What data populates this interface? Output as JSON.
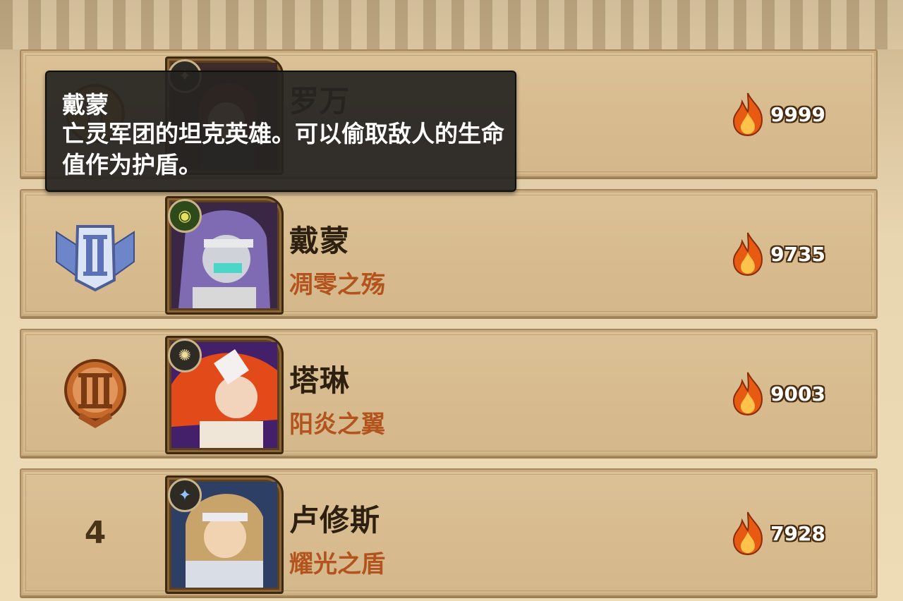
{
  "tooltip": {
    "title": "戴蒙",
    "description": "亡灵军团的坦克英雄。可以偷取敌人的生命值作为护盾。"
  },
  "leaderboard": {
    "entries": [
      {
        "rank_icon": "rank-1-emblem",
        "name": "罗万",
        "title": "",
        "power": "9999",
        "class_icon": "compass-class-icon",
        "portrait": "rowan-portrait"
      },
      {
        "rank_icon": "rank-2-silver-emblem",
        "name": "戴蒙",
        "title": "凋零之殇",
        "power": "9735",
        "class_icon": "eye-class-icon",
        "portrait": "daimon-portrait"
      },
      {
        "rank_icon": "rank-3-bronze-emblem",
        "name": "塔琳",
        "title": "阳炎之翼",
        "power": "9003",
        "class_icon": "sun-class-icon",
        "portrait": "talene-portrait"
      },
      {
        "rank_number": "4",
        "name": "卢修斯",
        "title": "耀光之盾",
        "power": "7928",
        "class_icon": "star-class-icon",
        "portrait": "lucius-portrait"
      }
    ]
  },
  "colors": {
    "panel": "#d6ba8c",
    "title_orange": "#b3541e",
    "tooltip_bg": "#262421",
    "flame": "#f07a1a"
  }
}
